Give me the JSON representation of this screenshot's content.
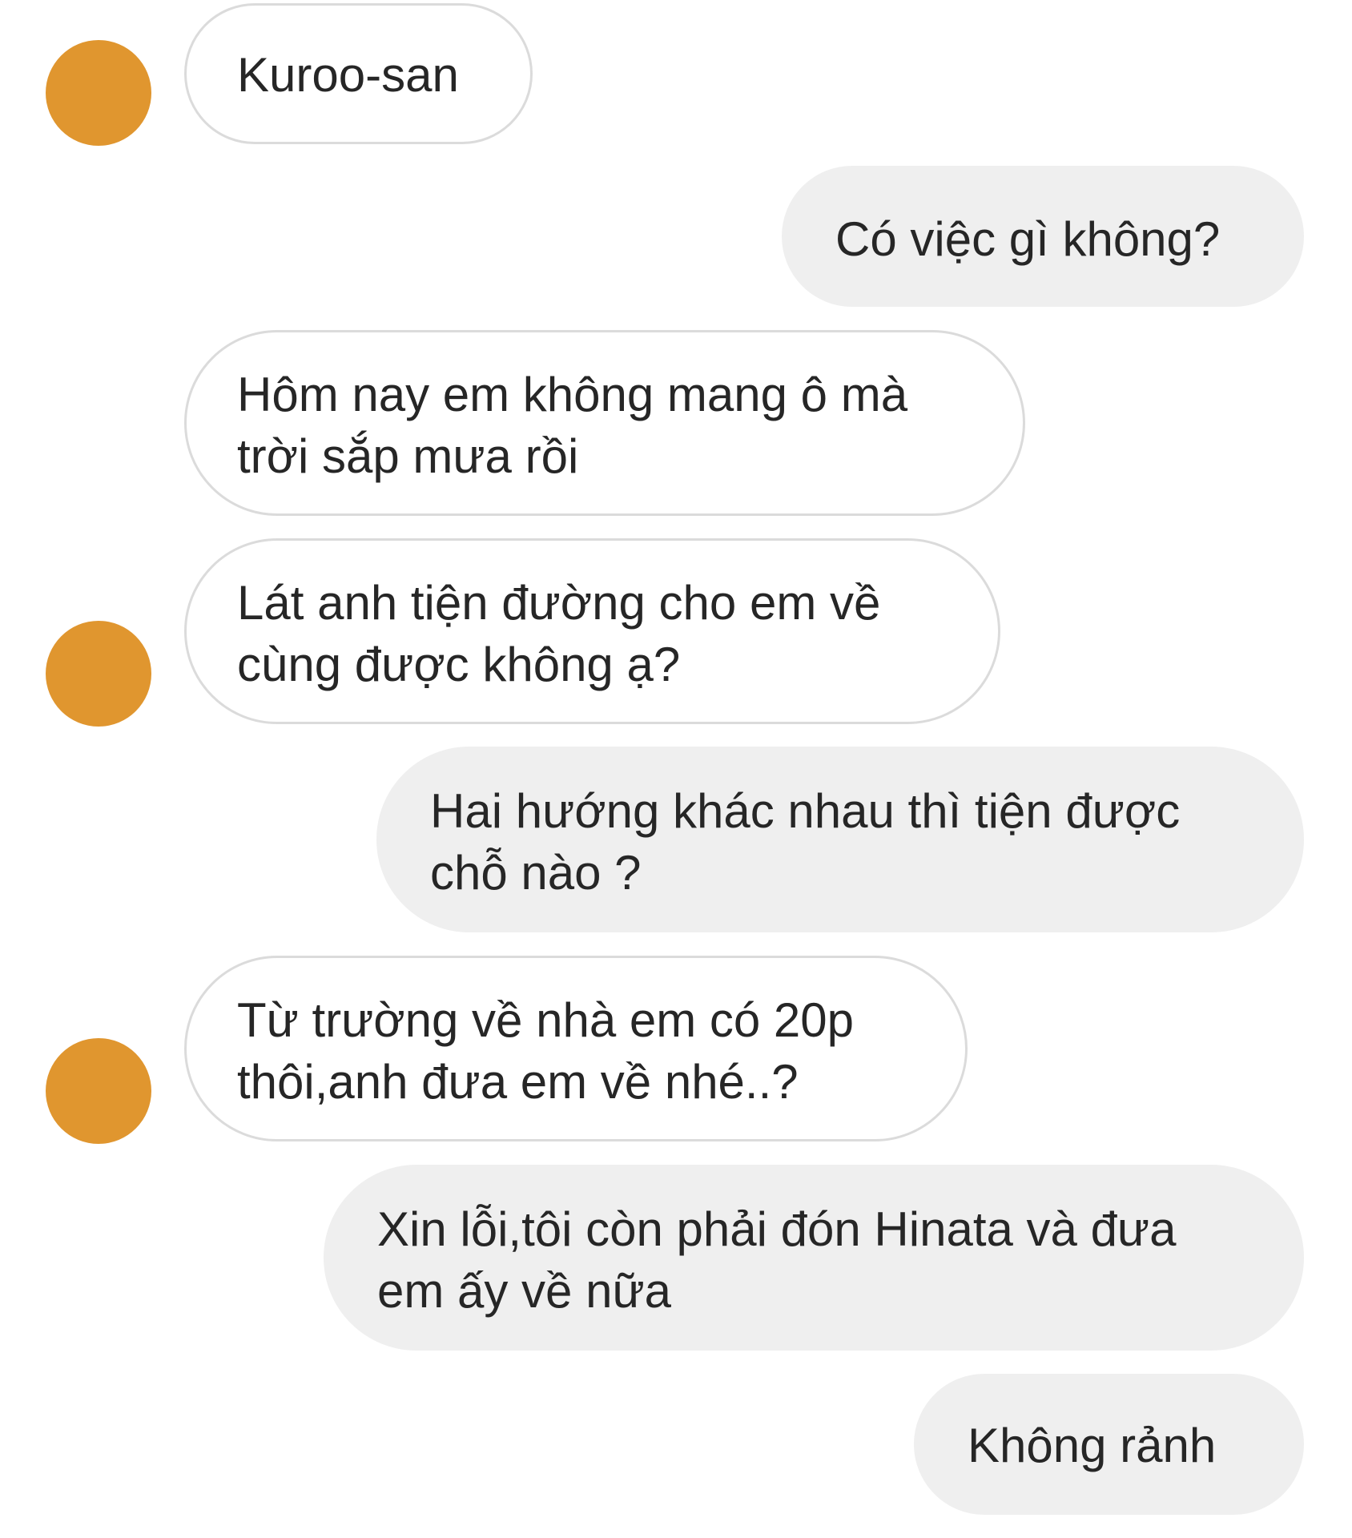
{
  "conversation": {
    "avatar_color": "#E0962F",
    "messages": [
      {
        "sender": "other",
        "lines": [
          "Kuroo-san"
        ]
      },
      {
        "sender": "me",
        "lines": [
          "Có việc gì không?"
        ]
      },
      {
        "sender": "other",
        "lines": [
          "Hôm nay em không mang ô mà",
          "trời sắp mưa rồi"
        ]
      },
      {
        "sender": "other",
        "lines": [
          "Lát anh tiện đường cho em về",
          "cùng được không ạ?"
        ]
      },
      {
        "sender": "me",
        "lines": [
          "Hai hướng khác nhau thì tiện được",
          "chỗ nào ?"
        ]
      },
      {
        "sender": "other",
        "lines": [
          "Từ trường về nhà em có 20p",
          "thôi,anh đưa em về nhé..?"
        ]
      },
      {
        "sender": "me",
        "lines": [
          "Xin lỗi,tôi còn phải đón Hinata và đưa",
          "em ấy về nữa"
        ]
      },
      {
        "sender": "me",
        "lines": [
          "Không rảnh"
        ]
      }
    ]
  }
}
